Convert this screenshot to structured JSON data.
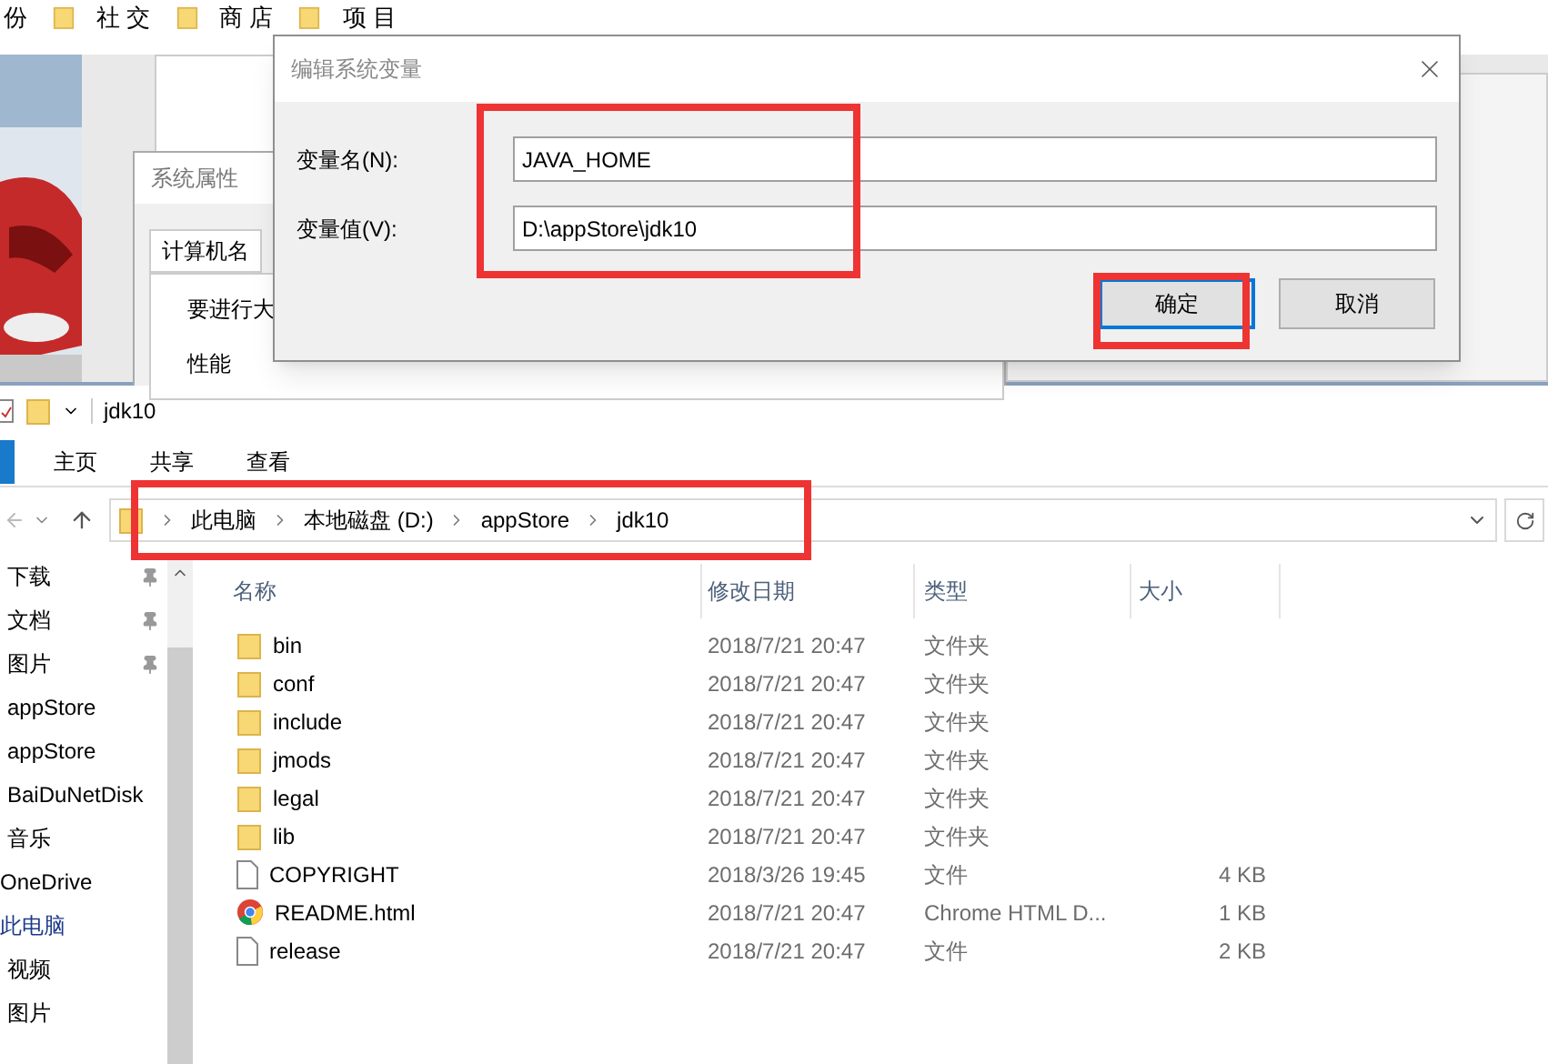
{
  "bookmarks": [
    {
      "label": "份",
      "folder": false
    },
    {
      "label": "社 交",
      "folder": true
    },
    {
      "label": "商 店",
      "folder": true
    },
    {
      "label": "项 目",
      "folder": true
    }
  ],
  "background_window": {
    "title": "系统属性",
    "tab": "计算机名",
    "text": "要进行大",
    "group": "性能"
  },
  "dialog": {
    "title": "编辑系统变量",
    "fields": [
      {
        "label": "变量名(N):",
        "value": "JAVA_HOME"
      },
      {
        "label": "变量值(V):",
        "value": "D:\\appStore\\jdk10"
      }
    ],
    "buttons": [
      {
        "label": "确定",
        "selected": true
      },
      {
        "label": "取消",
        "selected": false
      }
    ]
  },
  "explorer": {
    "title": "jdk10",
    "ribbon_tabs": [
      {
        "label": "主页",
        "selected": false
      },
      {
        "label": "共享",
        "selected": false
      },
      {
        "label": "查看",
        "selected": false
      }
    ],
    "breadcrumbs": [
      "此电脑",
      "本地磁盘 (D:)",
      "appStore",
      "jdk10"
    ],
    "nav": [
      {
        "label": "下载",
        "kind": "item",
        "pinned": true
      },
      {
        "label": "文档",
        "kind": "item",
        "pinned": true
      },
      {
        "label": "图片",
        "kind": "item",
        "pinned": true
      },
      {
        "label": "appStore",
        "kind": "item",
        "pinned": false
      },
      {
        "label": "appStore",
        "kind": "item",
        "pinned": false
      },
      {
        "label": "BaiDuNetDisk",
        "kind": "item",
        "pinned": false
      },
      {
        "label": "音乐",
        "kind": "item",
        "pinned": false
      },
      {
        "label": "OneDrive",
        "kind": "root",
        "pinned": false
      },
      {
        "label": "此电脑",
        "kind": "root",
        "pinned": false,
        "children": [
          {
            "label": "视频",
            "pinned": false
          },
          {
            "label": "图片",
            "pinned": false
          }
        ]
      }
    ],
    "columns": [
      "名称",
      "修改日期",
      "类型",
      "大小"
    ],
    "rows": [
      {
        "name": "bin",
        "date": "2018/7/21 20:47",
        "type": "文件夹",
        "kind": "folder"
      },
      {
        "name": "conf",
        "date": "2018/7/21 20:47",
        "type": "文件夹",
        "kind": "folder"
      },
      {
        "name": "include",
        "date": "2018/7/21 20:47",
        "type": "文件夹",
        "kind": "folder"
      },
      {
        "name": "jmods",
        "date": "2018/7/21 20:47",
        "type": "文件夹",
        "kind": "folder"
      },
      {
        "name": "legal",
        "date": "2018/7/21 20:47",
        "type": "文件夹",
        "kind": "folder"
      },
      {
        "name": "lib",
        "date": "2018/7/21 20:47",
        "type": "文件夹",
        "kind": "folder"
      },
      {
        "name": "COPYRIGHT",
        "date": "2018/3/26 19:45",
        "type": "文件",
        "size": "4 KB",
        "kind": "file"
      },
      {
        "name": "README.html",
        "date": "2018/7/21 20:47",
        "type": "Chrome HTML D...",
        "size": "1 KB",
        "kind": "browser"
      },
      {
        "name": "release",
        "date": "2018/7/21 20:47",
        "type": "文件",
        "size": "2 KB",
        "kind": "file"
      }
    ]
  }
}
